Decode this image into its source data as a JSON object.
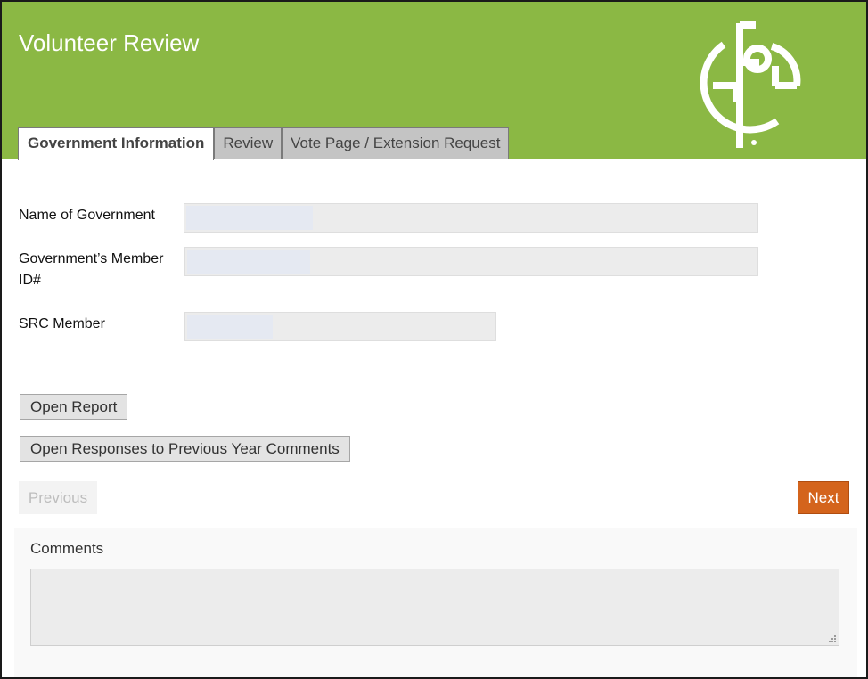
{
  "header": {
    "title": "Volunteer Review",
    "bg_color": "#8bb844",
    "logo_icon": "gfoa-logo-icon"
  },
  "tabs": [
    {
      "label": "Government Information",
      "active": true
    },
    {
      "label": "Review",
      "active": false
    },
    {
      "label": "Vote Page / Extension Request",
      "active": false
    }
  ],
  "form": {
    "government_name": {
      "label": "Name of Government",
      "value": ""
    },
    "member_id": {
      "label": "Government’s Member ID#",
      "value": ""
    },
    "src_member": {
      "label": "SRC Member",
      "value": ""
    }
  },
  "buttons": {
    "open_report": "Open Report",
    "open_responses": "Open Responses to Previous Year Comments",
    "previous": "Previous",
    "next": "Next",
    "next_color": "#d4641c"
  },
  "comments": {
    "label": "Comments",
    "value": ""
  }
}
